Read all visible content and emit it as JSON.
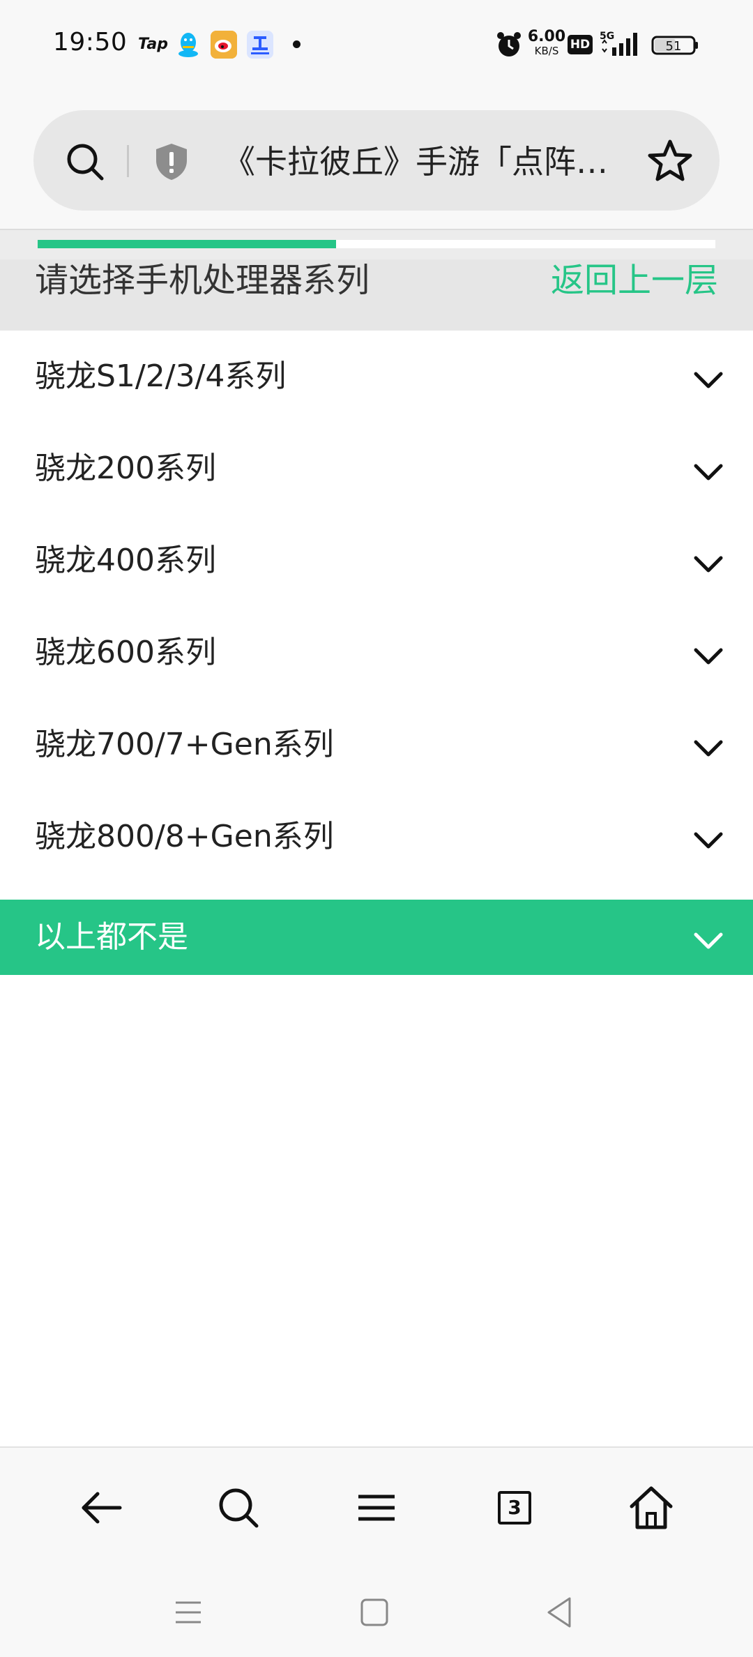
{
  "status_bar": {
    "time": "19:50",
    "notification_icons": [
      "tap-icon",
      "qq-icon",
      "weibo-icon",
      "xiaobao-icon",
      "dot-icon"
    ],
    "tap_text": "Tap",
    "network_speed_value": "6.00",
    "network_speed_unit": "KB/S",
    "hd_label": "HD",
    "network_type": "5G",
    "battery_level": "51"
  },
  "address_bar": {
    "title": "《卡拉彼丘》手游「点阵…"
  },
  "progress": {
    "fraction": 0.44,
    "color": "#26c587"
  },
  "header": {
    "title": "请选择手机处理器系列",
    "back_label": "返回上一层"
  },
  "list": {
    "items": [
      {
        "label": "骁龙S1/2/3/4系列"
      },
      {
        "label": "骁龙200系列"
      },
      {
        "label": "骁龙400系列"
      },
      {
        "label": "骁龙600系列"
      },
      {
        "label": "骁龙700/7+Gen系列"
      },
      {
        "label": "骁龙800/8+Gen系列"
      },
      {
        "label": "以上都不是",
        "selected": true
      }
    ]
  },
  "toolbar": {
    "tabs_count": "3",
    "icons": [
      "back-arrow-icon",
      "search-icon",
      "menu-icon",
      "tabs-icon",
      "home-icon"
    ]
  },
  "navbar": {
    "icons": [
      "recents-icon",
      "home-square-icon",
      "back-triangle-icon"
    ]
  },
  "colors": {
    "accent": "#26c587",
    "background": "#f8f8f8",
    "header_bg": "#e6e6e6"
  }
}
